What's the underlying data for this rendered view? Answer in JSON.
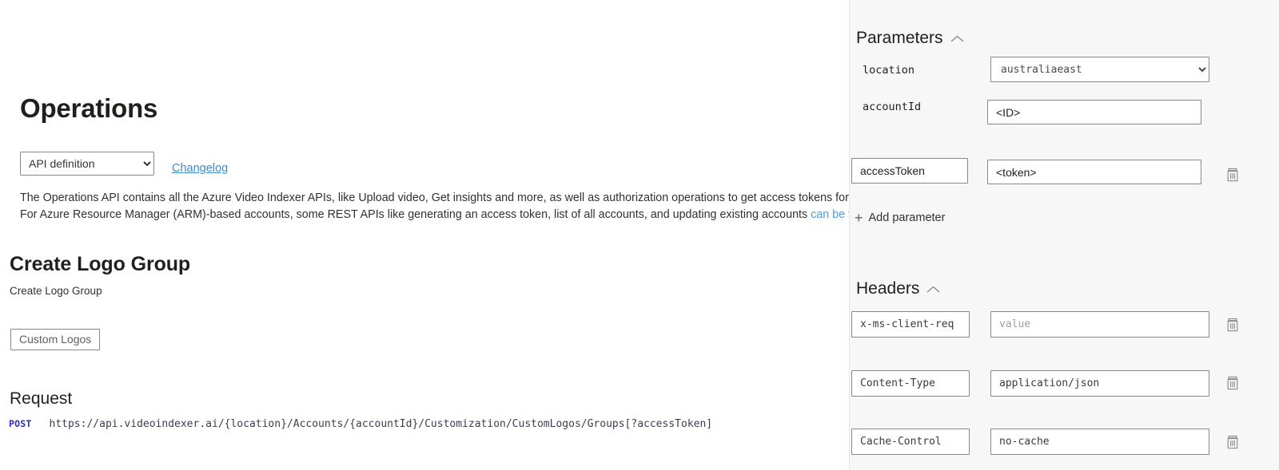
{
  "doc": {
    "title": "Operations",
    "api_definition_select": {
      "selected": "API definition",
      "options": [
        "API definition"
      ]
    },
    "changelog_link": "Changelog",
    "description_line1": "The Operations API contains all the Azure Video Indexer APIs, like Upload video, Get insights and more, as well as authorization operations to get access tokens for ca",
    "description_line2_pre": "For Azure Resource Manager (ARM)-based accounts, some REST APIs like generating an access token, list of all accounts, and updating existing accounts ",
    "description_line2_link": "can be foun",
    "operation_title": "Create Logo Group",
    "operation_subtitle": "Create Logo Group",
    "tag_button": "Custom Logos",
    "request_heading": "Request",
    "request_method": "POST",
    "request_url": "https://api.videoindexer.ai/{location}/Accounts/{accountId}/Customization/CustomLogos/Groups[?accessToken]"
  },
  "panel": {
    "parameters": {
      "heading": "Parameters",
      "collapse_icon": "chevron-up-icon",
      "rows": [
        {
          "name": "location",
          "name_editable": false,
          "control": "select",
          "value": "australiaeast",
          "options": [
            "australiaeast"
          ],
          "deletable": false
        },
        {
          "name": "accountId",
          "name_editable": false,
          "control": "text",
          "value": "<ID>",
          "placeholder": "",
          "deletable": false
        },
        {
          "name": "accessToken",
          "name_editable": true,
          "control": "text",
          "value": "<token>",
          "placeholder": "",
          "deletable": true
        }
      ],
      "add_label": "Add parameter",
      "add_icon": "plus-icon"
    },
    "headers": {
      "heading": "Headers",
      "collapse_icon": "chevron-up-icon",
      "rows": [
        {
          "name": "x-ms-client-req",
          "value": "",
          "placeholder": "value",
          "deletable": true
        },
        {
          "name": "Content-Type",
          "value": "application/json",
          "placeholder": "value",
          "deletable": true
        },
        {
          "name": "Cache-Control",
          "value": "no-cache",
          "placeholder": "value",
          "deletable": true
        }
      ]
    },
    "delete_icon": "trash-icon"
  },
  "colors": {
    "link": "#3b8bd4",
    "panel_bg": "#f7f7f7",
    "method_post": "#2b2bbd",
    "text": "#201f1e"
  }
}
